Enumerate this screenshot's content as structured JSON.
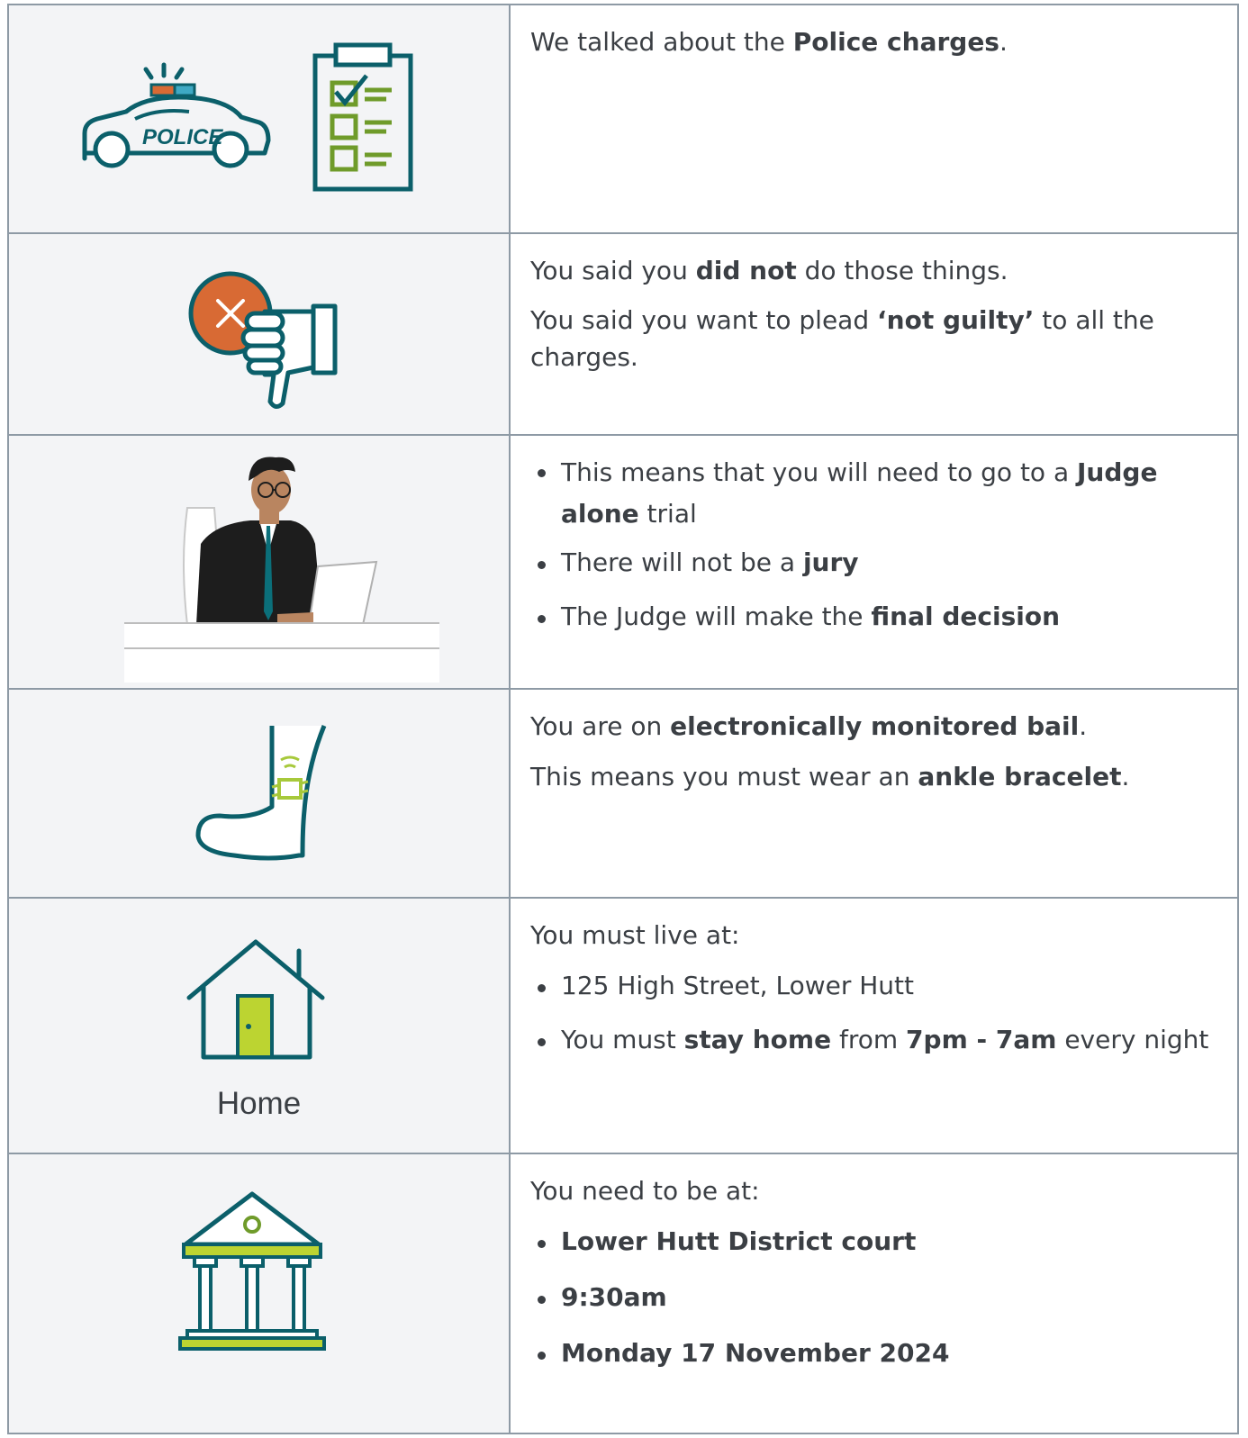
{
  "rows": [
    {
      "icons": [
        "police-car-icon",
        "checklist-icon"
      ],
      "car_text": "POLICE",
      "paragraphs": [
        {
          "pre": "We talked about the ",
          "bold": "Police charges",
          "post": "."
        }
      ]
    },
    {
      "icons": [
        "thumbs-down-cross-icon"
      ],
      "paragraphs": [
        {
          "pre": "You said you ",
          "bold": "did not",
          "post": " do those things."
        },
        {
          "pre": "You said you want to plead ",
          "bold": "‘not guilty’",
          "post": " to all the charges."
        }
      ]
    },
    {
      "icons": [
        "judge-at-desk-icon"
      ],
      "bullets": [
        {
          "pre": "This means that you will need to go to a ",
          "bold": "Judge alone",
          "post": " trial"
        },
        {
          "pre": "There will not be a ",
          "bold": "jury",
          "post": ""
        },
        {
          "pre": "The Judge will make the ",
          "bold": "final decision",
          "post": ""
        }
      ]
    },
    {
      "icons": [
        "ankle-bracelet-icon"
      ],
      "paragraphs": [
        {
          "pre": "You are on ",
          "bold": "electronically monitored bail",
          "post": "."
        },
        {
          "pre": "This means you must wear an ",
          "bold": "ankle bracelet",
          "post": "."
        }
      ]
    },
    {
      "icons": [
        "house-icon"
      ],
      "icon_label": "Home",
      "intro": "You must live at:",
      "bullet1": "125 High Street, Lower Hutt",
      "bullet2": {
        "pre": "You must ",
        "bold1": "stay home",
        "mid": " from ",
        "bold2": "7pm - 7am",
        "post": " every night"
      }
    },
    {
      "icons": [
        "courthouse-icon"
      ],
      "intro": "You need to be at:",
      "bullets": [
        "Lower Hutt District court",
        "9:30am",
        "Monday 17 November 2024"
      ]
    }
  ],
  "colors": {
    "teal": "#0b5f6a",
    "green": "#a7c93b",
    "orange": "#d86a34",
    "border": "#8e9aa5",
    "icon_bg": "#f3f4f6"
  }
}
